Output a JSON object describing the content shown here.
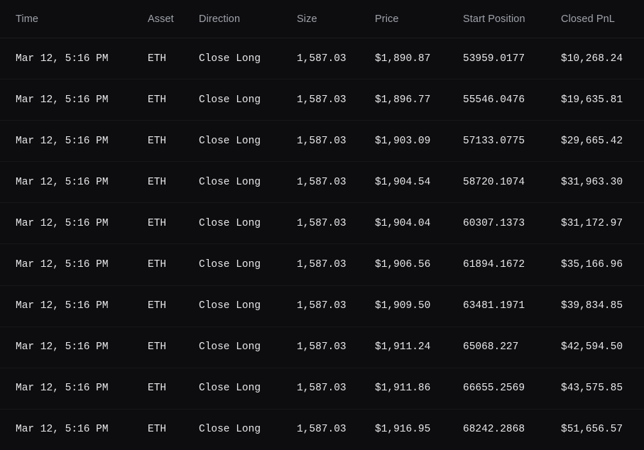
{
  "table": {
    "columns": [
      {
        "key": "time",
        "label": "Time"
      },
      {
        "key": "asset",
        "label": "Asset"
      },
      {
        "key": "direction",
        "label": "Direction"
      },
      {
        "key": "size",
        "label": "Size"
      },
      {
        "key": "price",
        "label": "Price"
      },
      {
        "key": "start_position",
        "label": "Start Position"
      },
      {
        "key": "closed_pnl",
        "label": "Closed PnL"
      }
    ],
    "colors": {
      "background": "#0d0d0f",
      "header_text": "#9ea2aa",
      "cell_text": "#e8e8ea",
      "positive": "#24c08a",
      "divider": "#17171b"
    },
    "rows": [
      {
        "time": "Mar 12, 5:16 PM",
        "asset": "ETH",
        "direction": "Close Long",
        "size": "1,587.03",
        "price": "$1,890.87",
        "start_position": "53959.0177",
        "closed_pnl": "$10,268.24"
      },
      {
        "time": "Mar 12, 5:16 PM",
        "asset": "ETH",
        "direction": "Close Long",
        "size": "1,587.03",
        "price": "$1,896.77",
        "start_position": "55546.0476",
        "closed_pnl": "$19,635.81"
      },
      {
        "time": "Mar 12, 5:16 PM",
        "asset": "ETH",
        "direction": "Close Long",
        "size": "1,587.03",
        "price": "$1,903.09",
        "start_position": "57133.0775",
        "closed_pnl": "$29,665.42"
      },
      {
        "time": "Mar 12, 5:16 PM",
        "asset": "ETH",
        "direction": "Close Long",
        "size": "1,587.03",
        "price": "$1,904.54",
        "start_position": "58720.1074",
        "closed_pnl": "$31,963.30"
      },
      {
        "time": "Mar 12, 5:16 PM",
        "asset": "ETH",
        "direction": "Close Long",
        "size": "1,587.03",
        "price": "$1,904.04",
        "start_position": "60307.1373",
        "closed_pnl": "$31,172.97"
      },
      {
        "time": "Mar 12, 5:16 PM",
        "asset": "ETH",
        "direction": "Close Long",
        "size": "1,587.03",
        "price": "$1,906.56",
        "start_position": "61894.1672",
        "closed_pnl": "$35,166.96"
      },
      {
        "time": "Mar 12, 5:16 PM",
        "asset": "ETH",
        "direction": "Close Long",
        "size": "1,587.03",
        "price": "$1,909.50",
        "start_position": "63481.1971",
        "closed_pnl": "$39,834.85"
      },
      {
        "time": "Mar 12, 5:16 PM",
        "asset": "ETH",
        "direction": "Close Long",
        "size": "1,587.03",
        "price": "$1,911.24",
        "start_position": "65068.227",
        "closed_pnl": "$42,594.50"
      },
      {
        "time": "Mar 12, 5:16 PM",
        "asset": "ETH",
        "direction": "Close Long",
        "size": "1,587.03",
        "price": "$1,911.86",
        "start_position": "66655.2569",
        "closed_pnl": "$43,575.85"
      },
      {
        "time": "Mar 12, 5:16 PM",
        "asset": "ETH",
        "direction": "Close Long",
        "size": "1,587.03",
        "price": "$1,916.95",
        "start_position": "68242.2868",
        "closed_pnl": "$51,656.57"
      }
    ]
  }
}
